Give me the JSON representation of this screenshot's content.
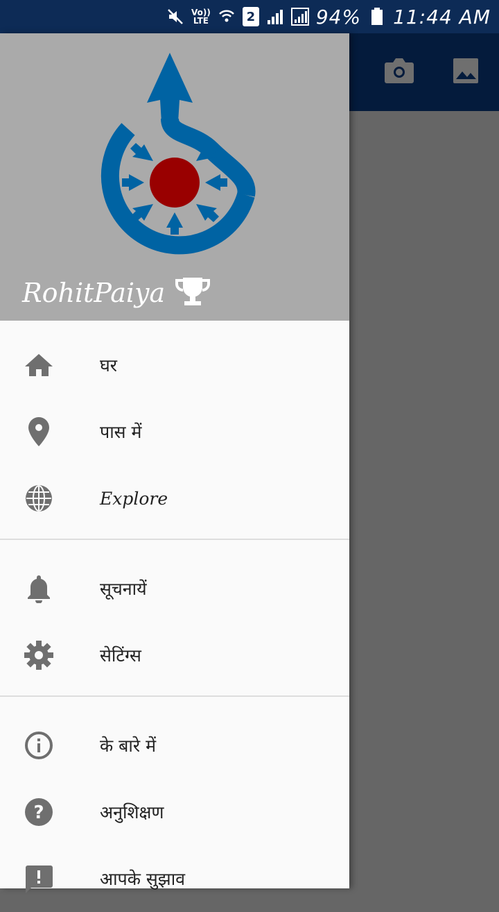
{
  "status_bar": {
    "volte_top": "Vo))",
    "volte_bottom": "LTE",
    "sim": "2",
    "battery": "94%",
    "time": "11:44 AM"
  },
  "app_bar": {
    "camera_icon": "camera-icon",
    "gallery_icon": "image-icon"
  },
  "drawer": {
    "username": "RohitPaiya",
    "trophy_icon": "trophy-icon",
    "menu": [
      {
        "label": "घर",
        "icon": "home-icon"
      },
      {
        "label": "पास में",
        "icon": "location-pin-icon"
      },
      {
        "label": "Explore",
        "icon": "globe-icon"
      },
      {
        "label": "सूचनायें",
        "icon": "bell-icon"
      },
      {
        "label": "सेटिंग्स",
        "icon": "gear-icon"
      },
      {
        "label": "के बारे में",
        "icon": "info-icon"
      },
      {
        "label": "अनुशिक्षण",
        "icon": "help-icon"
      },
      {
        "label": "आपके सुझाव",
        "icon": "feedback-icon"
      }
    ]
  },
  "colors": {
    "status_bar": "#0d2b56",
    "app_bar": "#041b3c",
    "header_bg": "#aaaaaa",
    "logo_blue": "#0063a3",
    "logo_red": "#990000",
    "icon_gray": "#6f6f6f"
  }
}
